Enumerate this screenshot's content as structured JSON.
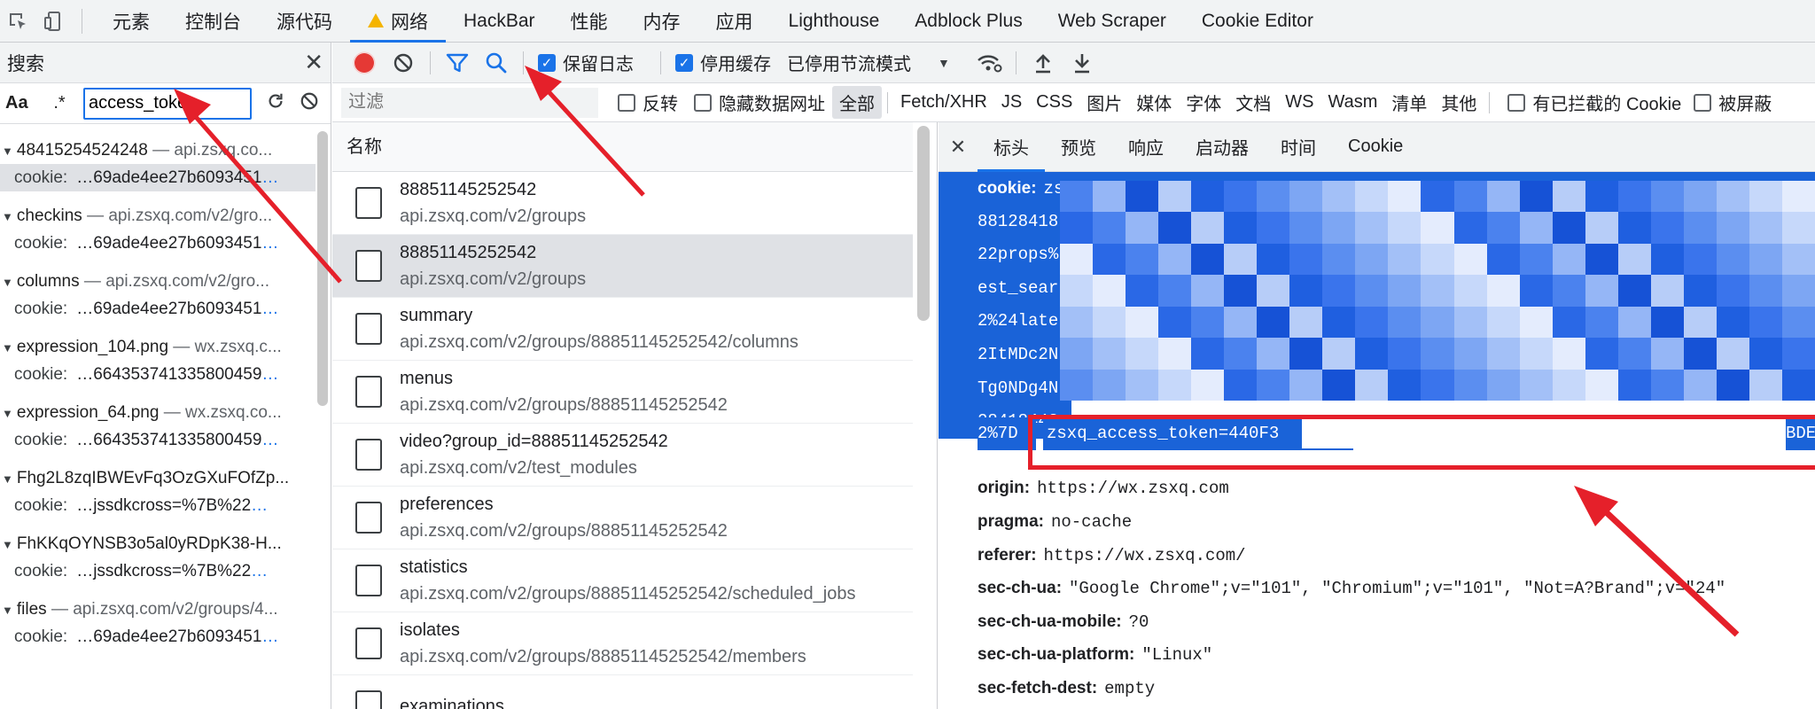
{
  "topbar": {
    "tabs": [
      "元素",
      "控制台",
      "源代码",
      "网络",
      "HackBar",
      "性能",
      "内存",
      "应用",
      "Lighthouse",
      "Adblock Plus",
      "Web Scraper",
      "Cookie Editor"
    ],
    "active_tab": "网络"
  },
  "search": {
    "title": "搜索",
    "case_label": "Aa",
    "regex_label": ".*",
    "query": "access_token",
    "results": [
      {
        "name": "48415254524248",
        "url": "api.zsxq.co...",
        "line_key": "cookie:",
        "line_val": "…69ade4ee27b6093451",
        "selected": true
      },
      {
        "name": "checkins",
        "url": "api.zsxq.com/v2/gro...",
        "line_key": "cookie:",
        "line_val": "…69ade4ee27b6093451",
        "selected": false
      },
      {
        "name": "columns",
        "url": "api.zsxq.com/v2/gro...",
        "line_key": "cookie:",
        "line_val": "…69ade4ee27b6093451",
        "selected": false
      },
      {
        "name": "expression_104.png",
        "url": "wx.zsxq.c...",
        "line_key": "cookie:",
        "line_val": "…664353741335800459",
        "selected": false
      },
      {
        "name": "expression_64.png",
        "url": "wx.zsxq.co...",
        "line_key": "cookie:",
        "line_val": "…664353741335800459",
        "selected": false
      },
      {
        "name": "Fhg2L8zqIBWEvFq3OzGXuFOfZp...",
        "url": "",
        "line_key": "cookie:",
        "line_val": "…jssdkcross=%7B%22",
        "selected": false
      },
      {
        "name": "FhKKqOYNSB3o5al0yRDpK38-H...",
        "url": "",
        "line_key": "cookie:",
        "line_val": "…jssdkcross=%7B%22",
        "selected": false
      },
      {
        "name": "files",
        "url": "api.zsxq.com/v2/groups/4...",
        "line_key": "cookie:",
        "line_val": "…69ade4ee27b6093451",
        "selected": false
      }
    ]
  },
  "net_toolbar": {
    "preserve_log": "保留日志",
    "disable_cache": "停用缓存",
    "throttle": "已停用节流模式"
  },
  "filter": {
    "placeholder": "过滤",
    "invert": "反转",
    "hide_data_urls": "隐藏数据网址",
    "types": [
      "全部",
      "Fetch/XHR",
      "JS",
      "CSS",
      "图片",
      "媒体",
      "字体",
      "文档",
      "WS",
      "Wasm",
      "清单",
      "其他"
    ],
    "blocked_cookies": "有已拦截的 Cookie",
    "blocked": "被屏蔽"
  },
  "requests": {
    "header": "名称",
    "rows": [
      {
        "name": "88851145252542",
        "path": "api.zsxq.com/v2/groups",
        "selected": false
      },
      {
        "name": "88851145252542",
        "path": "api.zsxq.com/v2/groups",
        "selected": true
      },
      {
        "name": "summary",
        "path": "api.zsxq.com/v2/groups/88851145252542/columns",
        "selected": false
      },
      {
        "name": "menus",
        "path": "api.zsxq.com/v2/groups/88851145252542",
        "selected": false
      },
      {
        "name": "video?group_id=88851145252542",
        "path": "api.zsxq.com/v2/test_modules",
        "selected": false
      },
      {
        "name": "preferences",
        "path": "api.zsxq.com/v2/groups/88851145252542",
        "selected": false
      },
      {
        "name": "statistics",
        "path": "api.zsxq.com/v2/groups/88851145252542/scheduled_jobs",
        "selected": false
      },
      {
        "name": "isolates",
        "path": "api.zsxq.com/v2/groups/88851145252542/members",
        "selected": false
      },
      {
        "name": "examinations",
        "path": "",
        "selected": false
      }
    ]
  },
  "detail": {
    "tabs": [
      "标头",
      "预览",
      "响应",
      "启动器",
      "时间",
      "Cookie"
    ],
    "active_tab": "标头",
    "cookie_lines": [
      {
        "key": "cookie:",
        "val": "zsxqsessionid=c69ade4ee27b6093451"
      },
      {
        "key": "",
        "val": "88128418"
      },
      {
        "key": "",
        "val": "22props%"
      },
      {
        "key": "",
        "val": "est_sear"
      },
      {
        "key": "",
        "val": "2%24late"
      },
      {
        "key": "",
        "val": "2ItMDc2N"
      },
      {
        "key": "",
        "val": "Tg0NDg4N"
      },
      {
        "key": "",
        "val": "28418448"
      }
    ],
    "token_prefix": "2%7D",
    "token_text": "zsxq_access_token=440F3",
    "token_tail": "BDEAC15C",
    "headers": [
      {
        "key": "origin:",
        "val": "https://wx.zsxq.com"
      },
      {
        "key": "pragma:",
        "val": "no-cache"
      },
      {
        "key": "referer:",
        "val": "https://wx.zsxq.com/"
      },
      {
        "key": "sec-ch-ua:",
        "val": "\"Google Chrome\";v=\"101\", \"Chromium\";v=\"101\", \"Not=A?Brand\";v=\"24\""
      },
      {
        "key": "sec-ch-ua-mobile:",
        "val": "?0"
      },
      {
        "key": "sec-ch-ua-platform:",
        "val": "\"Linux\""
      },
      {
        "key": "sec-fetch-dest:",
        "val": "empty"
      },
      {
        "key": "sec-fetch-mode:",
        "val": "cors"
      }
    ]
  },
  "colors": {
    "accent": "#1a73e8",
    "selection": "#1a63d8",
    "highlight_box": "#e5202a",
    "arrow": "#e5202a",
    "record": "#e53935"
  },
  "icons": [
    "inspect-icon",
    "device-icon",
    "warning-icon",
    "record-icon",
    "clear-icon",
    "filter-icon",
    "search-icon",
    "refresh-icon",
    "wifi-settings-icon",
    "upload-icon",
    "download-icon",
    "close-icon"
  ]
}
